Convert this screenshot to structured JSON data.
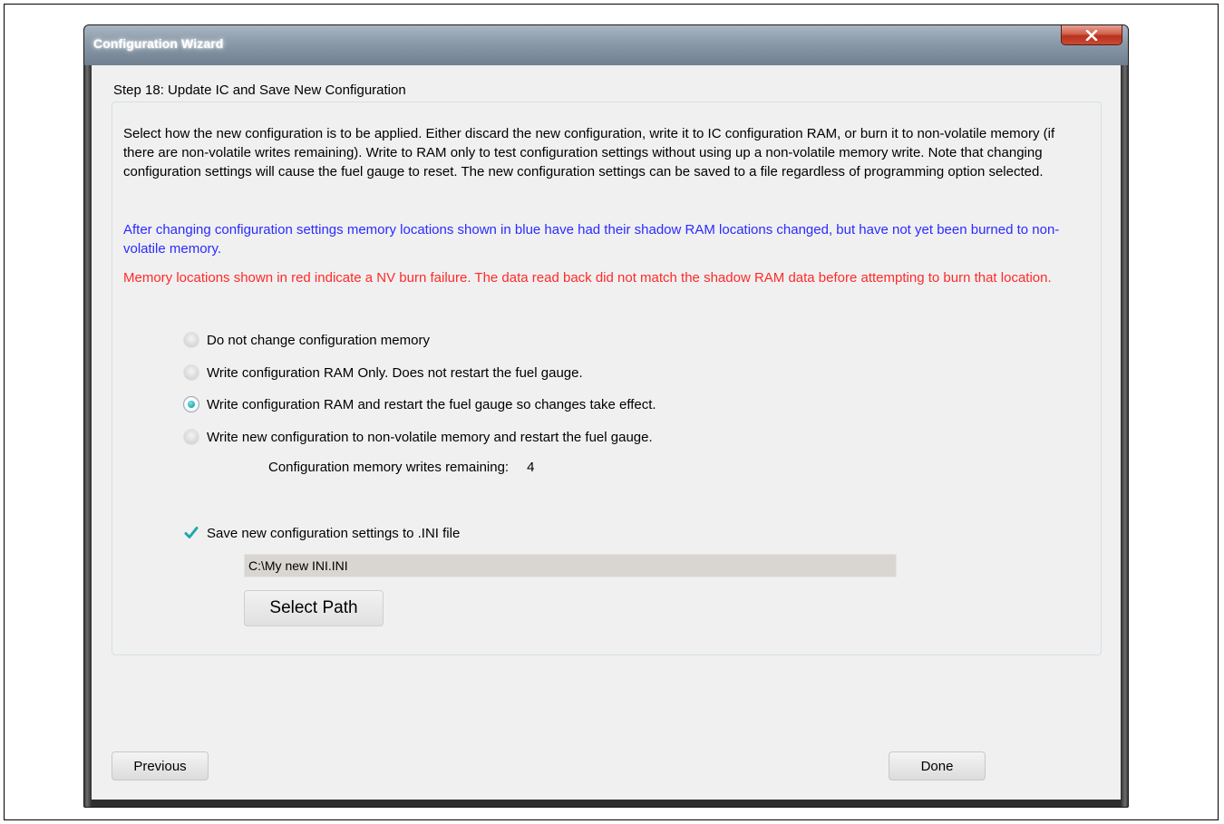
{
  "window": {
    "title": "Configuration Wizard",
    "close_label": "x"
  },
  "step": {
    "title": "Step 18: Update IC and Save New Configuration"
  },
  "description": "Select how the new configuration is to be applied. Either discard the new configuration, write it to IC configuration RAM, or burn it to non-volatile memory (if there are non-volatile writes remaining). Write to RAM only to test configuration settings without using up a non-volatile memory write. Note that changing configuration settings will cause the fuel gauge to reset. The new configuration settings can be saved to a file regardless of programming option selected.",
  "notes": {
    "blue": "After changing configuration settings memory locations shown in blue have had their shadow RAM locations changed, but have not yet been burned to non-volatile memory.",
    "red": "Memory locations shown in red indicate a NV burn failure. The data read back did not match the shadow RAM data before attempting to burn that location."
  },
  "options": [
    {
      "label": "Do not change configuration memory",
      "checked": false
    },
    {
      "label": "Write configuration RAM Only. Does not restart the fuel gauge.",
      "checked": false
    },
    {
      "label": "Write configuration RAM and restart the fuel gauge so changes take effect.",
      "checked": true
    },
    {
      "label": "Write new configuration to non-volatile memory and restart the fuel gauge.",
      "checked": false
    }
  ],
  "writes_remaining": {
    "label": "Configuration memory writes remaining:",
    "value": "4"
  },
  "save_ini": {
    "label": "Save new configuration settings to .INI file",
    "checked": true,
    "path": "C:\\My new INI.INI",
    "select_path_label": "Select Path"
  },
  "nav": {
    "previous_label": "Previous",
    "done_label": "Done"
  },
  "colors": {
    "blue_note": "#2b2bff",
    "red_note": "#ff2a2a",
    "accent": "#1fa7b0"
  }
}
